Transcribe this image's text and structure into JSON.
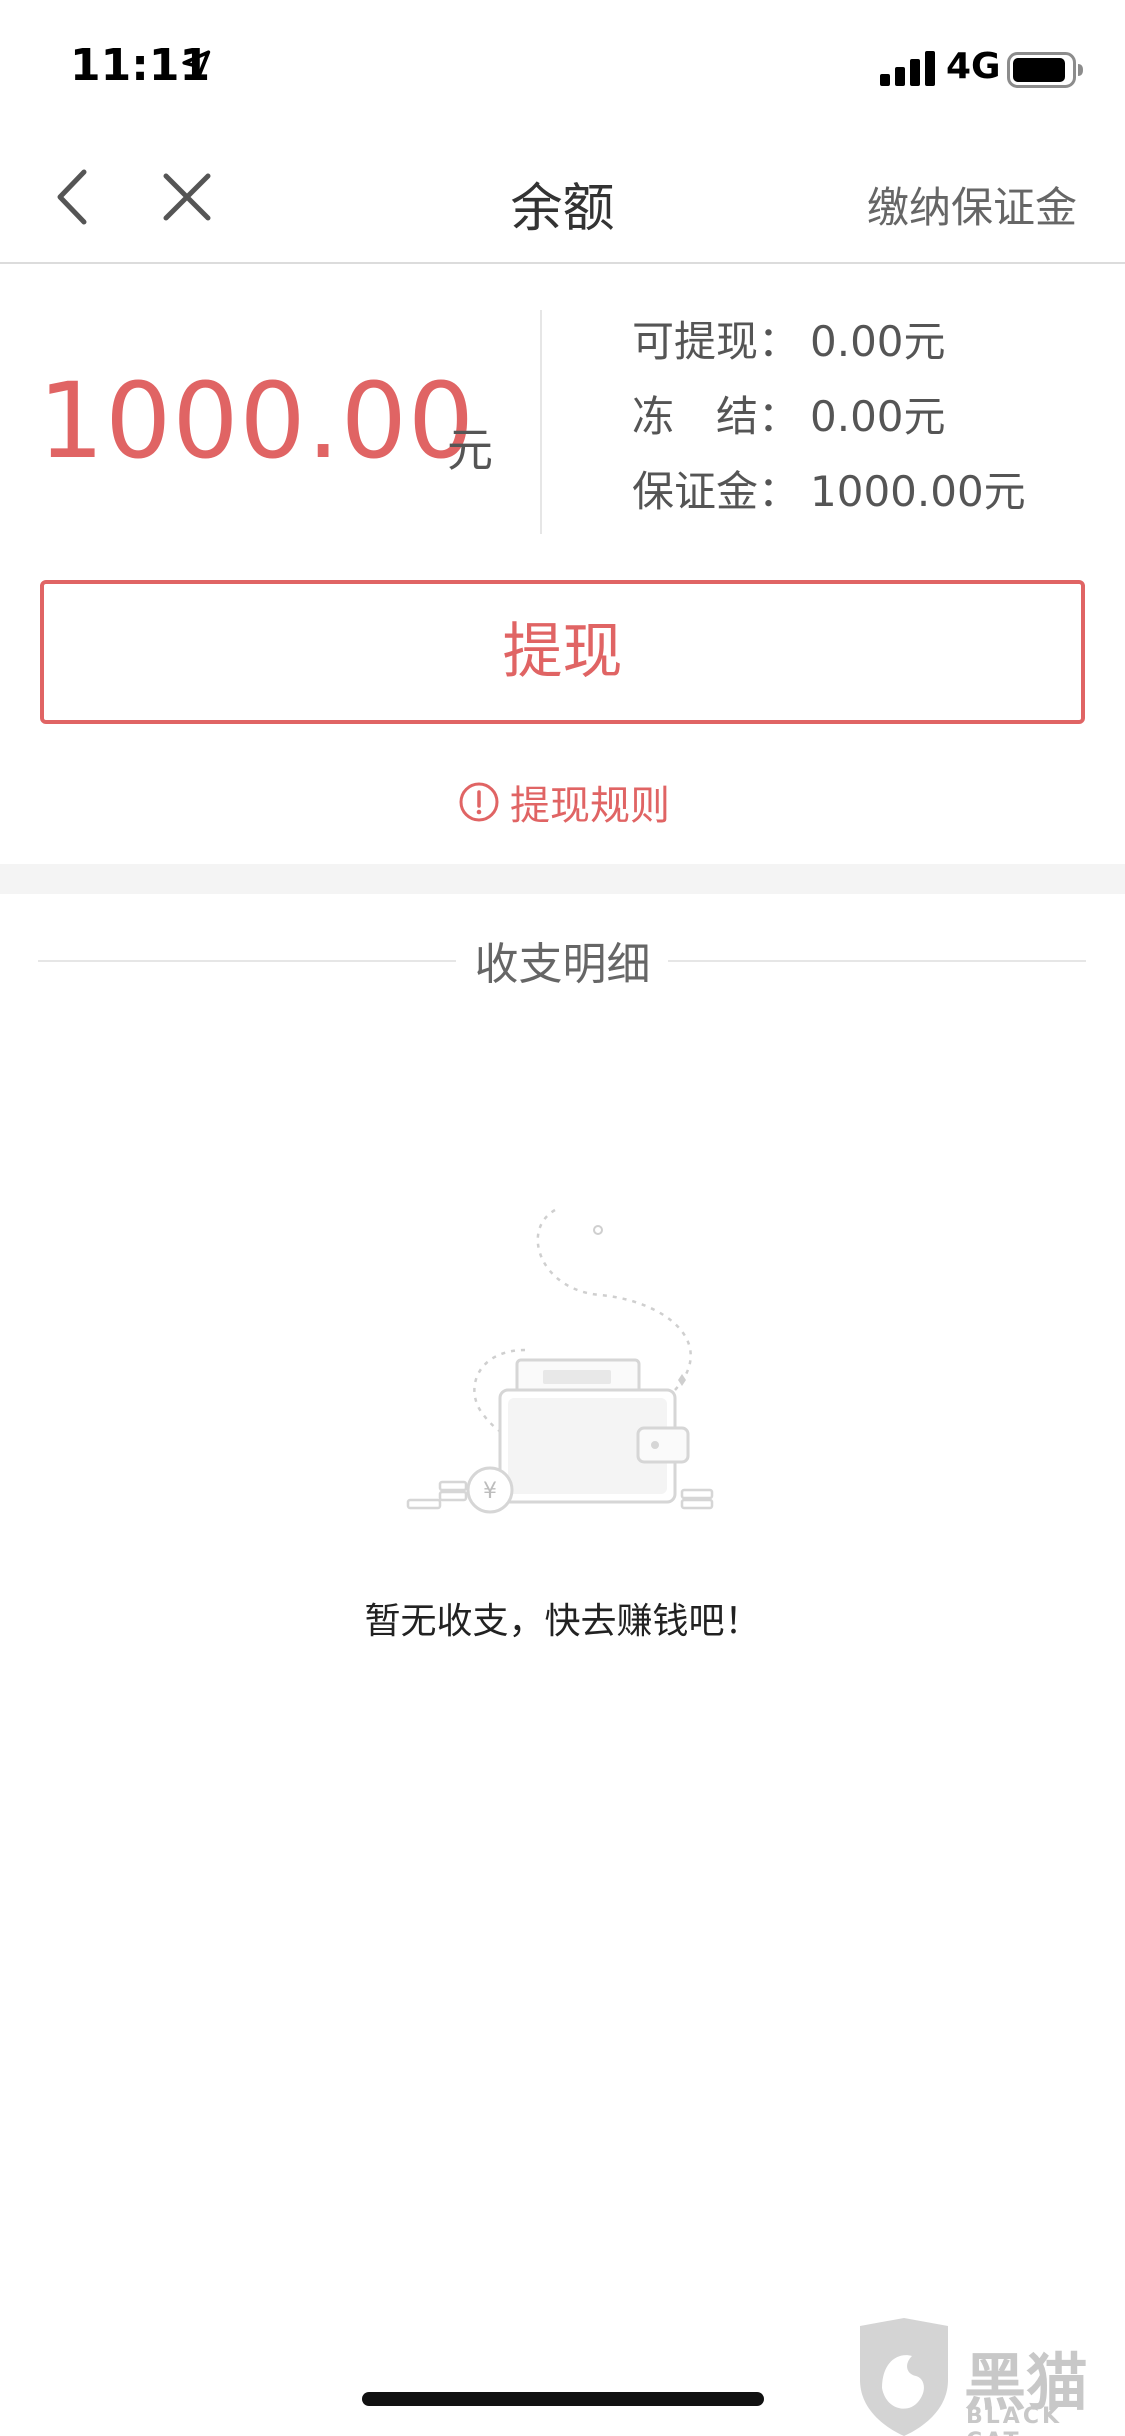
{
  "status_bar": {
    "time": "11:11",
    "network": "4G",
    "icons": [
      "location-arrow-icon",
      "signal-bars-icon",
      "battery-icon"
    ]
  },
  "nav": {
    "title": "余额",
    "right_action": "缴纳保证金",
    "icons": [
      "chevron-left-icon",
      "close-icon"
    ]
  },
  "balance": {
    "amount": "1000.00",
    "unit": "元",
    "details": [
      {
        "label": "可提现：",
        "value": "0.00元"
      },
      {
        "label": "冻　结：",
        "value": "0.00元"
      },
      {
        "label": "保证金：",
        "value": "1000.00元"
      }
    ]
  },
  "withdraw_button_label": "提现",
  "rules_link_label": "提现规则",
  "section_title": "收支明细",
  "empty_state": {
    "message": "暂无收支，快去赚钱吧！",
    "illustration": "empty-wallet-icon"
  },
  "watermark": {
    "text": "黑猫",
    "sub": "BLACK CAT"
  },
  "colors": {
    "accent": "#e06464",
    "divider": "#e6e6e6",
    "band": "#f4f4f4"
  }
}
